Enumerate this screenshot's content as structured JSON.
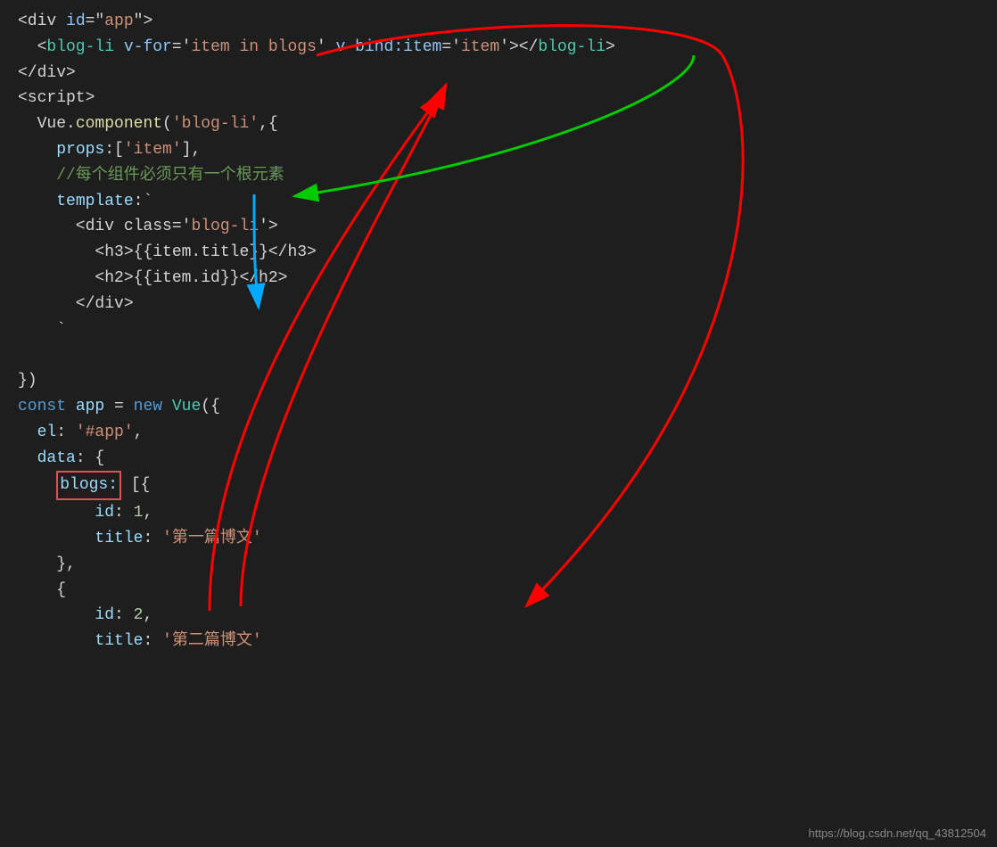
{
  "code": {
    "lines": [
      {
        "id": 1,
        "content": [
          {
            "text": "<div ",
            "cls": "c-white"
          },
          {
            "text": "id",
            "cls": "c-attr"
          },
          {
            "text": "=",
            "cls": "c-white"
          },
          {
            "text": "\"app\"",
            "cls": "c-orange"
          },
          {
            "text": ">",
            "cls": "c-white"
          }
        ]
      },
      {
        "id": 2,
        "content": [
          {
            "text": "  <",
            "cls": "c-white"
          },
          {
            "text": "blog-li",
            "cls": "c-tag"
          },
          {
            "text": " ",
            "cls": "c-white"
          },
          {
            "text": "v-for",
            "cls": "c-attr"
          },
          {
            "text": "=",
            "cls": "c-white"
          },
          {
            "text": "'item in blogs'",
            "cls": "c-orange"
          },
          {
            "text": " ",
            "cls": "c-white"
          },
          {
            "text": "v-bind",
            "cls": "c-attr"
          },
          {
            "text": ":item=",
            "cls": "c-white"
          },
          {
            "text": "'item'",
            "cls": "c-orange"
          },
          {
            "text": "></",
            "cls": "c-white"
          },
          {
            "text": "blog-li",
            "cls": "c-tag"
          },
          {
            "text": ">",
            "cls": "c-white"
          }
        ]
      },
      {
        "id": 3,
        "content": [
          {
            "text": "</div>",
            "cls": "c-white"
          }
        ]
      },
      {
        "id": 4,
        "content": [
          {
            "text": "<script>",
            "cls": "c-white"
          }
        ]
      },
      {
        "id": 5,
        "content": [
          {
            "text": "  Vue",
            "cls": "c-white"
          },
          {
            "text": ".",
            "cls": "c-white"
          },
          {
            "text": "component",
            "cls": "c-yellow"
          },
          {
            "text": "(",
            "cls": "c-white"
          },
          {
            "text": "'blog-li'",
            "cls": "c-orange"
          },
          {
            "text": ",{",
            "cls": "c-white"
          }
        ]
      },
      {
        "id": 6,
        "content": [
          {
            "text": "    props",
            "cls": "c-cyan"
          },
          {
            "text": ":[",
            "cls": "c-white"
          },
          {
            "text": "'item'",
            "cls": "c-orange"
          },
          {
            "text": "],",
            "cls": "c-white"
          }
        ]
      },
      {
        "id": 7,
        "content": [
          {
            "text": "    //每个组件必须只有一个根元素",
            "cls": "c-comment"
          }
        ]
      },
      {
        "id": 8,
        "content": [
          {
            "text": "    template",
            "cls": "c-cyan"
          },
          {
            "text": ":`",
            "cls": "c-white"
          }
        ]
      },
      {
        "id": 9,
        "content": [
          {
            "text": "      <div class=",
            "cls": "c-white"
          },
          {
            "text": "'blog-li'",
            "cls": "c-orange"
          },
          {
            "text": ">",
            "cls": "c-white"
          }
        ]
      },
      {
        "id": 10,
        "content": [
          {
            "text": "        <h3>{{item.title}}</h3>",
            "cls": "c-white"
          }
        ]
      },
      {
        "id": 11,
        "content": [
          {
            "text": "        <h2>{{item.id}}</h2>",
            "cls": "c-white"
          }
        ]
      },
      {
        "id": 12,
        "content": [
          {
            "text": "      </div>",
            "cls": "c-white"
          }
        ]
      },
      {
        "id": 13,
        "content": [
          {
            "text": "    `",
            "cls": "c-white"
          }
        ]
      },
      {
        "id": 14,
        "content": [
          {
            "text": "",
            "cls": "c-white"
          }
        ]
      },
      {
        "id": 15,
        "content": [
          {
            "text": "})",
            "cls": "c-white"
          }
        ]
      },
      {
        "id": 16,
        "content": [
          {
            "text": "const",
            "cls": "c-blue"
          },
          {
            "text": " app ",
            "cls": "c-cyan"
          },
          {
            "text": "= ",
            "cls": "c-white"
          },
          {
            "text": "new",
            "cls": "c-blue"
          },
          {
            "text": " ",
            "cls": "c-white"
          },
          {
            "text": "Vue",
            "cls": "c-green"
          },
          {
            "text": "({",
            "cls": "c-white"
          }
        ]
      },
      {
        "id": 17,
        "content": [
          {
            "text": "  el",
            "cls": "c-cyan"
          },
          {
            "text": ": ",
            "cls": "c-white"
          },
          {
            "text": "'#app'",
            "cls": "c-orange"
          },
          {
            "text": ",",
            "cls": "c-white"
          }
        ]
      },
      {
        "id": 18,
        "content": [
          {
            "text": "  data",
            "cls": "c-cyan"
          },
          {
            "text": ": {",
            "cls": "c-white"
          }
        ]
      },
      {
        "id": 19,
        "content": [
          {
            "text": "    ",
            "cls": "c-white"
          },
          {
            "text": "blogs:",
            "cls": "c-highlight"
          },
          {
            "text": " [{",
            "cls": "c-white"
          }
        ]
      },
      {
        "id": 20,
        "content": [
          {
            "text": "        id",
            "cls": "c-cyan"
          },
          {
            "text": ": ",
            "cls": "c-white"
          },
          {
            "text": "1",
            "cls": "c-num"
          },
          {
            "text": ",",
            "cls": "c-white"
          }
        ]
      },
      {
        "id": 21,
        "content": [
          {
            "text": "        title",
            "cls": "c-cyan"
          },
          {
            "text": ": ",
            "cls": "c-white"
          },
          {
            "text": "'第一篇博文'",
            "cls": "c-orange"
          }
        ]
      },
      {
        "id": 22,
        "content": [
          {
            "text": "    },",
            "cls": "c-white"
          }
        ]
      },
      {
        "id": 23,
        "content": [
          {
            "text": "    {",
            "cls": "c-white"
          }
        ]
      },
      {
        "id": 24,
        "content": [
          {
            "text": "        id",
            "cls": "c-cyan"
          },
          {
            "text": ": ",
            "cls": "c-white"
          },
          {
            "text": "2",
            "cls": "c-num"
          },
          {
            "text": ",",
            "cls": "c-white"
          }
        ]
      },
      {
        "id": 25,
        "content": [
          {
            "text": "        title",
            "cls": "c-cyan"
          },
          {
            "text": ": ",
            "cls": "c-white"
          },
          {
            "text": "'第二篇博文'",
            "cls": "c-orange"
          }
        ]
      }
    ]
  },
  "watermark": "https://blog.csdn.net/qq_43812504"
}
